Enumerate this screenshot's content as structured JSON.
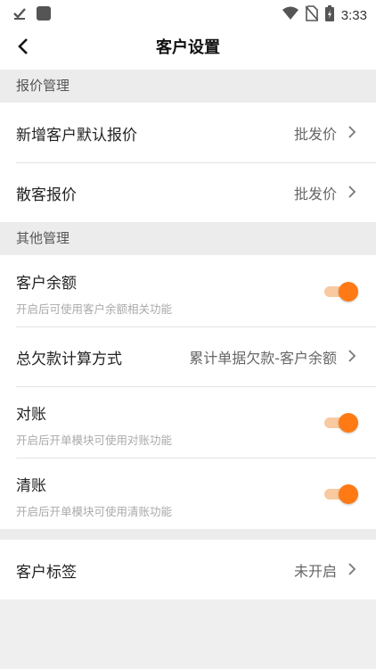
{
  "status_bar": {
    "time": "3:33"
  },
  "app_bar": {
    "title": "客户设置"
  },
  "sections": {
    "quote": {
      "header": "报价管理",
      "items": [
        {
          "label": "新增客户默认报价",
          "value": "批发价"
        },
        {
          "label": "散客报价",
          "value": "批发价"
        }
      ]
    },
    "other": {
      "header": "其他管理",
      "balance": {
        "label": "客户余额",
        "sub": "开启后可使用客户余额相关功能",
        "enabled": true
      },
      "debt": {
        "label": "总欠款计算方式",
        "value": "累计单据欠款-客户余额"
      },
      "reconcile": {
        "label": "对账",
        "sub": "开启后开单模块可使用对账功能",
        "enabled": true
      },
      "settle": {
        "label": "清账",
        "sub": "开启后开单模块可使用清账功能",
        "enabled": true
      }
    },
    "tags": {
      "label": "客户标签",
      "value": "未开启"
    }
  },
  "colors": {
    "accent": "#ff7a14",
    "accent_track": "#f9c9a0"
  }
}
